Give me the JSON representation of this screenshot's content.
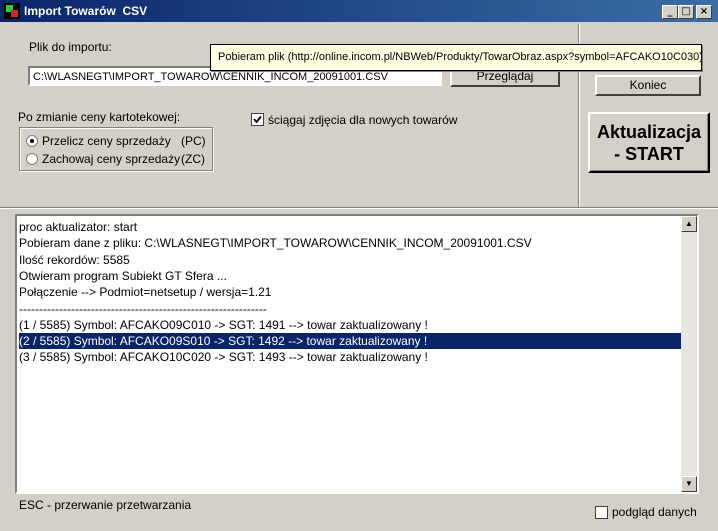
{
  "window": {
    "title": "Import Towarów  CSV",
    "minimize": "_",
    "maximize": "□",
    "close": "×"
  },
  "import": {
    "file_label": "Plik do importu:",
    "file_value": "C:\\WLASNEGT\\IMPORT_TOWAROW\\CENNIK_INCOM_20091001.CSV",
    "browse_label": "Przeglądaj"
  },
  "price": {
    "group_label": "Po zmianie ceny kartotekowej:",
    "option1": "Przelicz ceny sprzedaży",
    "option1_code": "(PC)",
    "option2": "Zachowaj ceny sprzedaży",
    "option2_code": "(ZC)",
    "selected": "option1"
  },
  "images_checkbox": {
    "label": "ściągaj zdjęcia dla nowych towarów",
    "checked": true
  },
  "buttons": {
    "end_label": "Koniec",
    "start_line1": "Aktualizacja",
    "start_line2": "- START"
  },
  "tooltip": {
    "text": "Pobieram plik (http://online.incom.pl/NBWeb/Produkty/TowarObraz.aspx?symbol=AFCAKO10C030)"
  },
  "log": {
    "lines": [
      "proc aktualizator: start",
      "Pobieram dane z pliku: C:\\WLASNEGT\\IMPORT_TOWAROW\\CENNIK_INCOM_20091001.CSV",
      "Ilość rekordów: 5585",
      "Otwieram program Subiekt GT Sfera ...",
      "Połączenie --> Podmiot=netsetup / wersja=1.21",
      "--------------------------------------------------------------",
      "(1 / 5585) Symbol: AFCAKO09C010 -> SGT: 1491 --> towar zaktualizowany !",
      "(2 / 5585) Symbol: AFCAKO09S010 -> SGT: 1492 --> towar zaktualizowany !",
      "(3 / 5585) Symbol: AFCAKO10C020 -> SGT: 1493 --> towar zaktualizowany !"
    ],
    "selected_index": 7
  },
  "footer": {
    "esc_text": "ESC - przerwanie przetwarzania",
    "preview_label": "podgląd danych",
    "preview_checked": false
  },
  "colors": {
    "titlebar": "#0a246a",
    "selection": "#0a246a",
    "face": "#d4d0c8",
    "tooltip_bg": "#ffffe1"
  }
}
